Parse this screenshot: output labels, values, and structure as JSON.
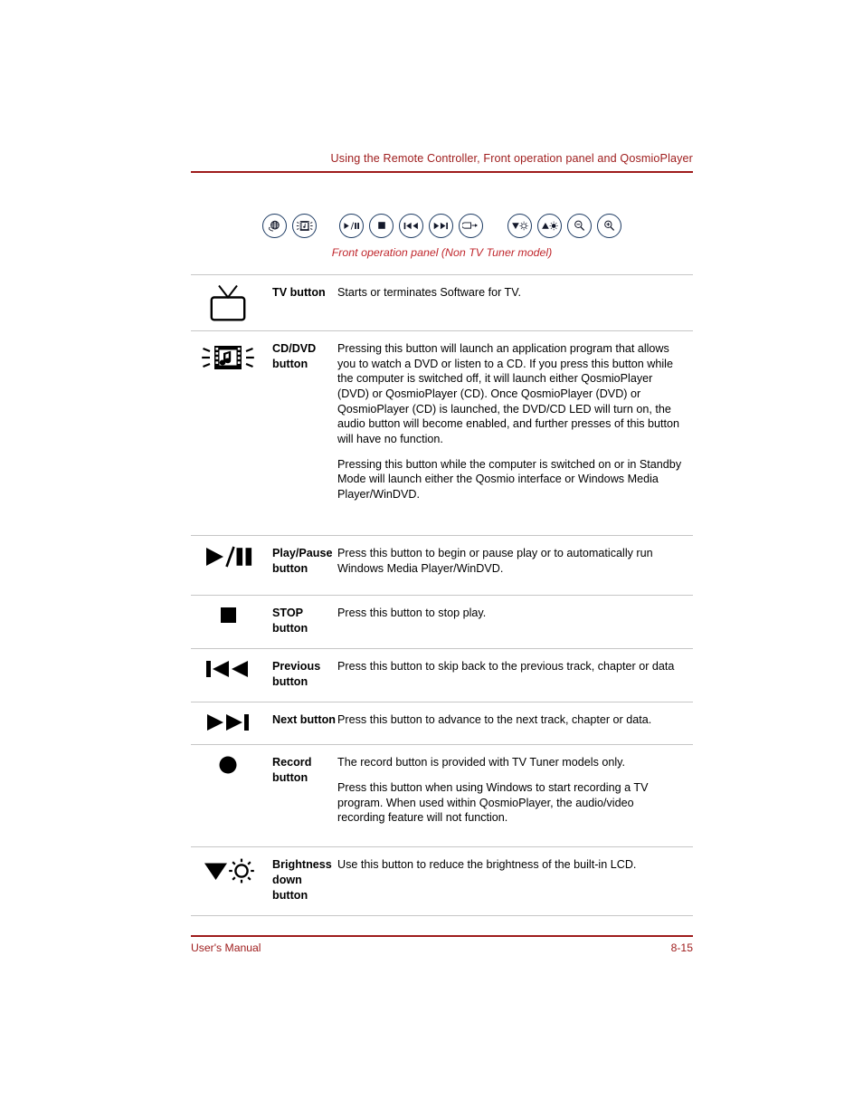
{
  "header": {
    "running_head": "Using the Remote Controller, Front operation panel and QosmioPlayer",
    "rule_color": "#9e1b1b"
  },
  "figure": {
    "caption": "Front operation panel (Non TV Tuner model)",
    "caption_color": "#c0272d",
    "button_outline_color": "#1d3b63",
    "buttons": [
      {
        "icon": "tv-globe-icon",
        "label": "TV"
      },
      {
        "icon": "cd-dvd-film-note-icon",
        "label": "CD/DVD"
      },
      {
        "icon": "play-pause-icon",
        "label": "Play/Pause"
      },
      {
        "icon": "stop-icon",
        "label": "STOP"
      },
      {
        "icon": "previous-track-icon",
        "label": "Previous"
      },
      {
        "icon": "next-track-icon",
        "label": "Next"
      },
      {
        "icon": "eject-exit-icon",
        "label": "Eject"
      },
      {
        "icon": "brightness-down-icon",
        "label": "Brightness down"
      },
      {
        "icon": "brightness-up-icon",
        "label": "Brightness up"
      },
      {
        "icon": "zoom-out-icon",
        "label": "Zoom out"
      },
      {
        "icon": "zoom-in-icon",
        "label": "Zoom in"
      }
    ]
  },
  "table": {
    "rows": [
      {
        "icon": "tv-set-icon",
        "name": "TV button",
        "paragraphs": [
          "Starts or terminates Software for TV."
        ]
      },
      {
        "icon": "cd-dvd-film-note-icon",
        "name": "CD/DVD button",
        "paragraphs": [
          "Pressing this button will launch an application program that allows you to watch a DVD or listen to a CD. If you press this button while the computer is switched off, it will launch either QosmioPlayer (DVD) or QosmioPlayer (CD). Once QosmioPlayer (DVD) or QosmioPlayer (CD) is launched, the DVD/CD LED will turn on, the audio button will become enabled, and further presses of this button will have no function.",
          "Pressing this button while the computer is switched on or in Standby Mode will launch either the Qosmio interface or Windows Media Player/WinDVD."
        ]
      },
      {
        "icon": "play-pause-icon",
        "name": "Play/Pause button",
        "paragraphs": [
          "Press this button to begin or pause play or to automatically run Windows Media Player/WinDVD."
        ]
      },
      {
        "icon": "stop-icon",
        "name": "STOP button",
        "paragraphs": [
          "Press this button to stop play."
        ]
      },
      {
        "icon": "previous-track-icon",
        "name": "Previous button",
        "paragraphs": [
          "Press this button to skip back to the previous track, chapter or data"
        ]
      },
      {
        "icon": "next-track-icon",
        "name": "Next button",
        "paragraphs": [
          "Press this button to advance to the next track, chapter or data."
        ]
      },
      {
        "icon": "record-icon",
        "name": "Record button",
        "paragraphs": [
          "The record button is provided with TV Tuner models only.",
          "Press this button when using Windows to start recording a TV program. When used within QosmioPlayer, the audio/video recording feature will not function."
        ]
      },
      {
        "icon": "brightness-down-icon",
        "name": "Brightness down button",
        "paragraphs": [
          "Use this button to reduce the brightness of the built-in LCD."
        ]
      }
    ]
  },
  "footer": {
    "left": "User's Manual",
    "right": "8-15",
    "color": "#9e1b1b"
  }
}
